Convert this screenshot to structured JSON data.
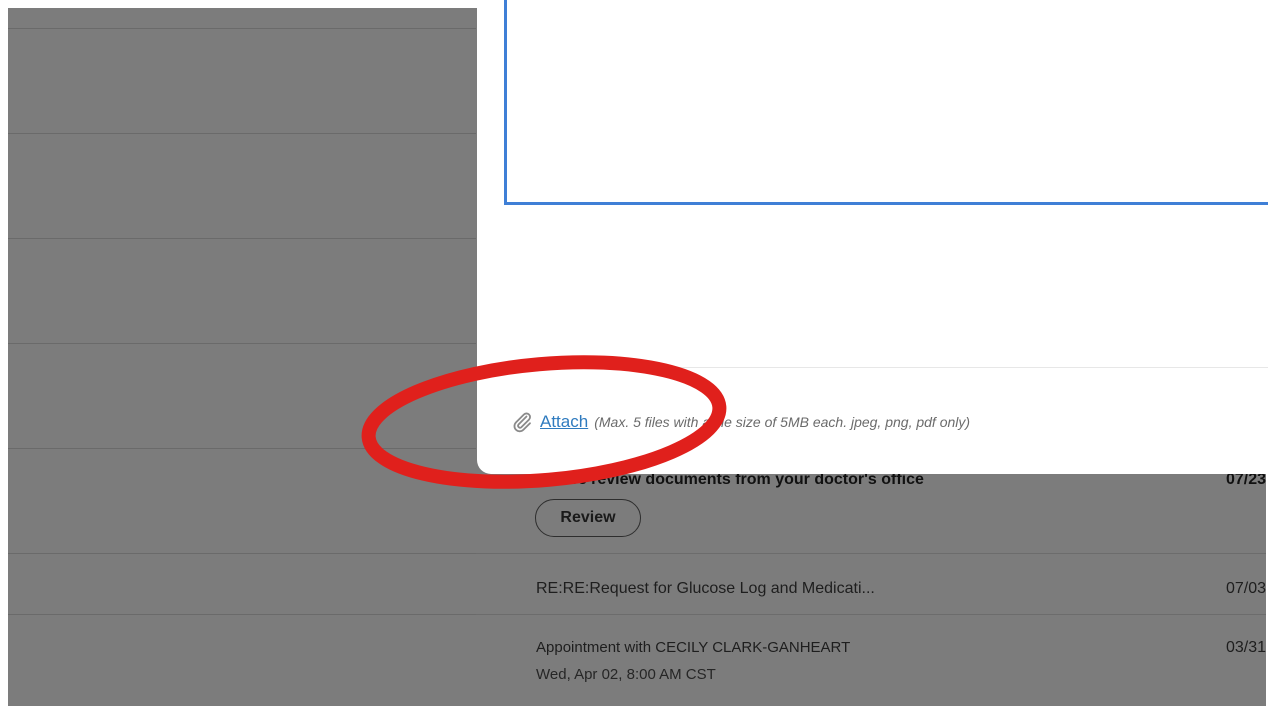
{
  "modal": {
    "attach_label": "Attach",
    "attach_note": "(Max. 5 files with a file size of 5MB each. jpeg, png, pdf only)"
  },
  "messages": [
    {
      "subject": "Please review documents from your doctor's office",
      "date": "07/23",
      "action_label": "Review",
      "unread": true
    },
    {
      "subject": "RE:RE:Request for Glucose Log and Medicati...",
      "date": "07/03",
      "unread": false
    },
    {
      "subject": "Appointment with CECILY CLARK-GANHEART",
      "subtitle": "Wed, Apr 02, 8:00 AM CST",
      "date": "03/31",
      "unread": false
    }
  ],
  "colors": {
    "accent": "#3f7fd6",
    "link": "#2f7bbf",
    "annotation": "#e0201c",
    "overlay": "#7c7c7c"
  },
  "icons": {
    "attach": "paperclip-icon"
  }
}
